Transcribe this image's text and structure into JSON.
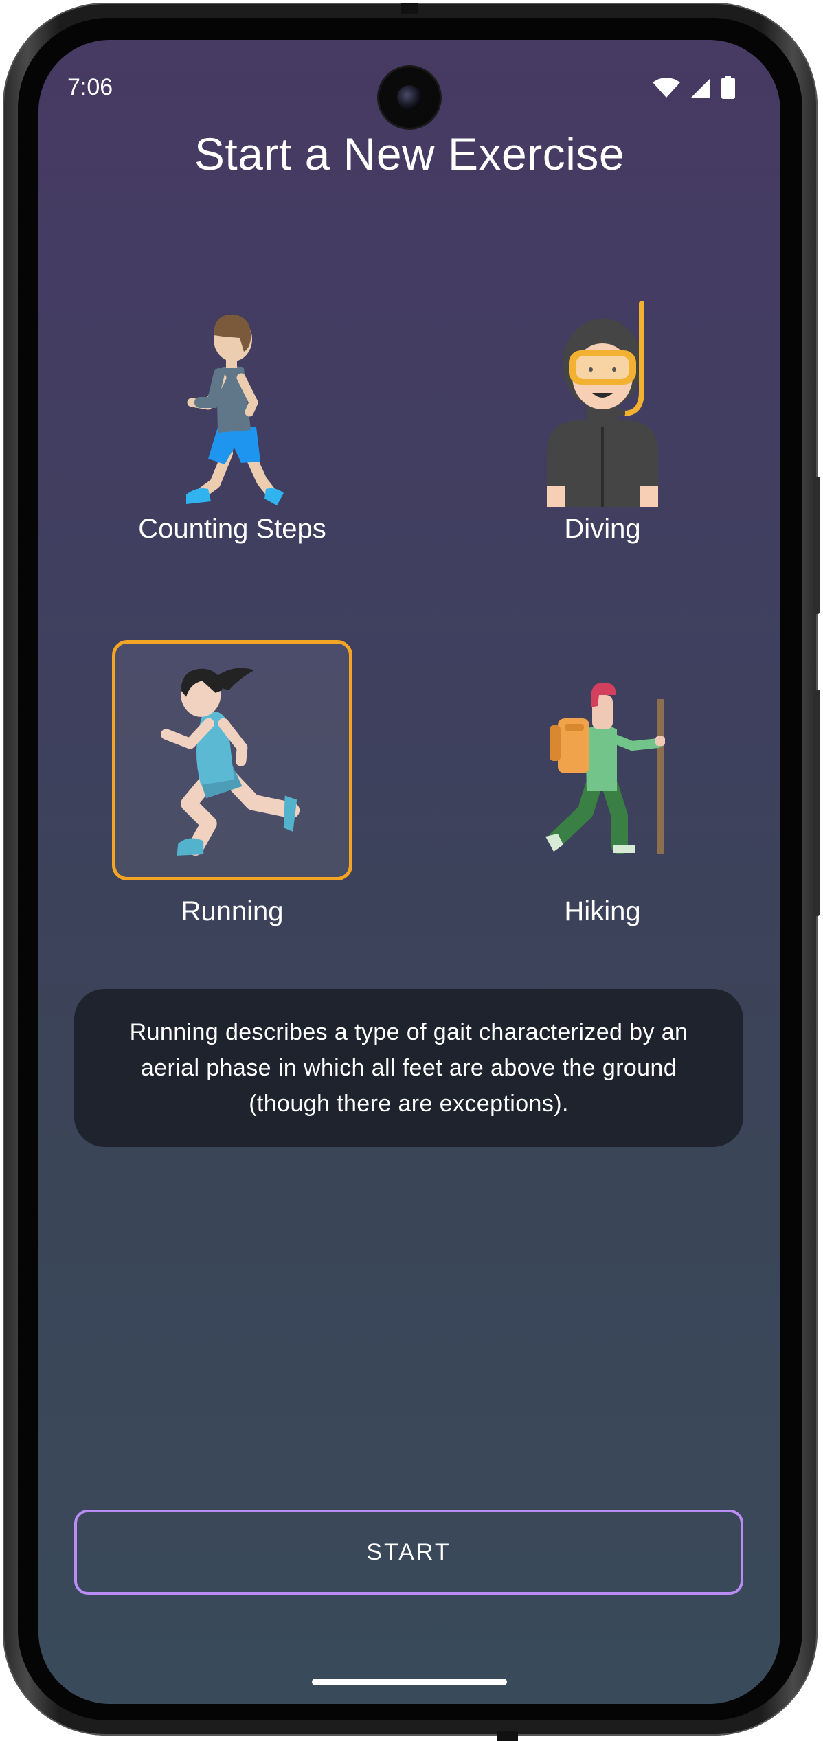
{
  "status_bar": {
    "time": "7:06"
  },
  "screen": {
    "title": "Start a New Exercise"
  },
  "exercises": [
    {
      "label": "Counting Steps",
      "icon": "person-walking-icon",
      "selected": false
    },
    {
      "label": "Diving",
      "icon": "diver-with-snorkel-icon",
      "selected": false
    },
    {
      "label": "Running",
      "icon": "woman-running-icon",
      "selected": true
    },
    {
      "label": "Hiking",
      "icon": "hiker-with-backpack-icon",
      "selected": false
    }
  ],
  "description": "Running describes a type of gait characterized by an aerial phase in which all feet are above the ground (though there are exceptions).",
  "start_button": {
    "label": "START"
  },
  "colors": {
    "selection_border": "#f4a524",
    "start_button_border": "#bb8cf6",
    "description_background": "#1f232e",
    "background_top": "#473a63",
    "background_bottom": "#394a5a"
  }
}
